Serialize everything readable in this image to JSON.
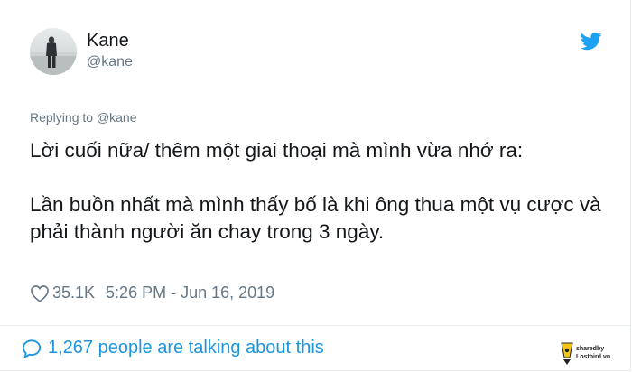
{
  "user": {
    "name": "Kane",
    "handle": "@kane"
  },
  "reply": {
    "prefix": "Replying to",
    "mention": "@kane"
  },
  "tweet": {
    "paragraph1": "Lời cuối nữa/ thêm một giai thoại mà mình vừa nhớ ra:",
    "paragraph2": "Lần buồn nhất mà mình thấy bố là khi ông thua một vụ cược và phải thành người ăn chay trong 3 ngày."
  },
  "meta": {
    "likes": "35.1K",
    "timestamp": "5:26 PM - Jun 16, 2019"
  },
  "talking": {
    "label": "1,267 people are talking about this"
  },
  "watermark": {
    "line1": "sharedby",
    "line2": "Lostbird.vn"
  },
  "colors": {
    "twitter_blue": "#1da1f2",
    "link_blue": "#1b95e0",
    "muted_gray": "#657786",
    "text_dark": "#14171a",
    "watermark_yellow": "#f5c518"
  },
  "icons": {
    "brand": "twitter-bird-icon",
    "like": "heart-icon",
    "comments": "speech-bubble-icon"
  }
}
